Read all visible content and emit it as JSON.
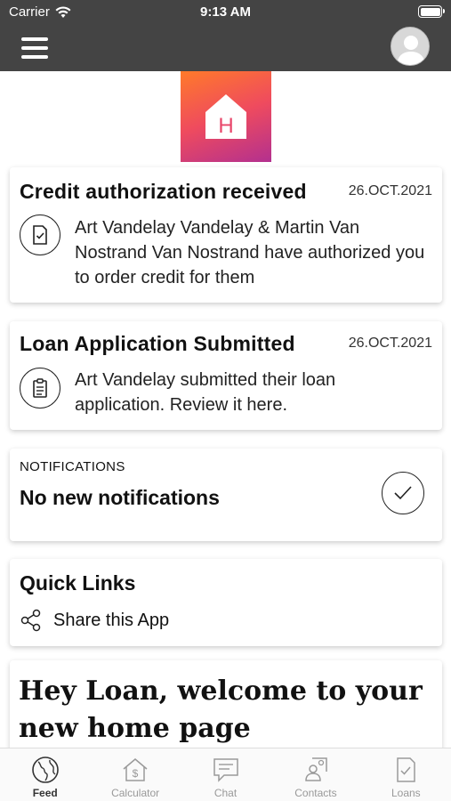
{
  "status_bar": {
    "carrier": "Carrier",
    "time": "9:13 AM"
  },
  "logo": {
    "letter": "H"
  },
  "notifications_feed": [
    {
      "title": "Credit authorization received",
      "date": "26.OCT.2021",
      "icon": "document-check-icon",
      "text": "Art Vandelay Vandelay & Martin Van Nostrand Van Nostrand have authorized you to order credit for them"
    },
    {
      "title": "Loan Application Submitted",
      "date": "26.OCT.2021",
      "icon": "clipboard-icon",
      "text": "Art Vandelay submitted their loan application. Review it here."
    }
  ],
  "notifications_panel": {
    "label": "NOTIFICATIONS",
    "empty_text": "No new notifications"
  },
  "quick_links": {
    "title": "Quick Links",
    "items": [
      {
        "label": "Share this App",
        "icon": "share-icon"
      }
    ]
  },
  "welcome": {
    "text": "Hey Loan, welcome to your new home page"
  },
  "tabs": [
    {
      "label": "Feed",
      "icon": "globe-icon",
      "active": true
    },
    {
      "label": "Calculator",
      "icon": "calculator-house-icon",
      "active": false
    },
    {
      "label": "Chat",
      "icon": "chat-icon",
      "active": false
    },
    {
      "label": "Contacts",
      "icon": "contacts-icon",
      "active": false
    },
    {
      "label": "Loans",
      "icon": "loans-document-icon",
      "active": false
    }
  ],
  "colors": {
    "header": "#444444",
    "brand_gradient_start": "#ff7a2a",
    "brand_gradient_end": "#b3308f"
  }
}
